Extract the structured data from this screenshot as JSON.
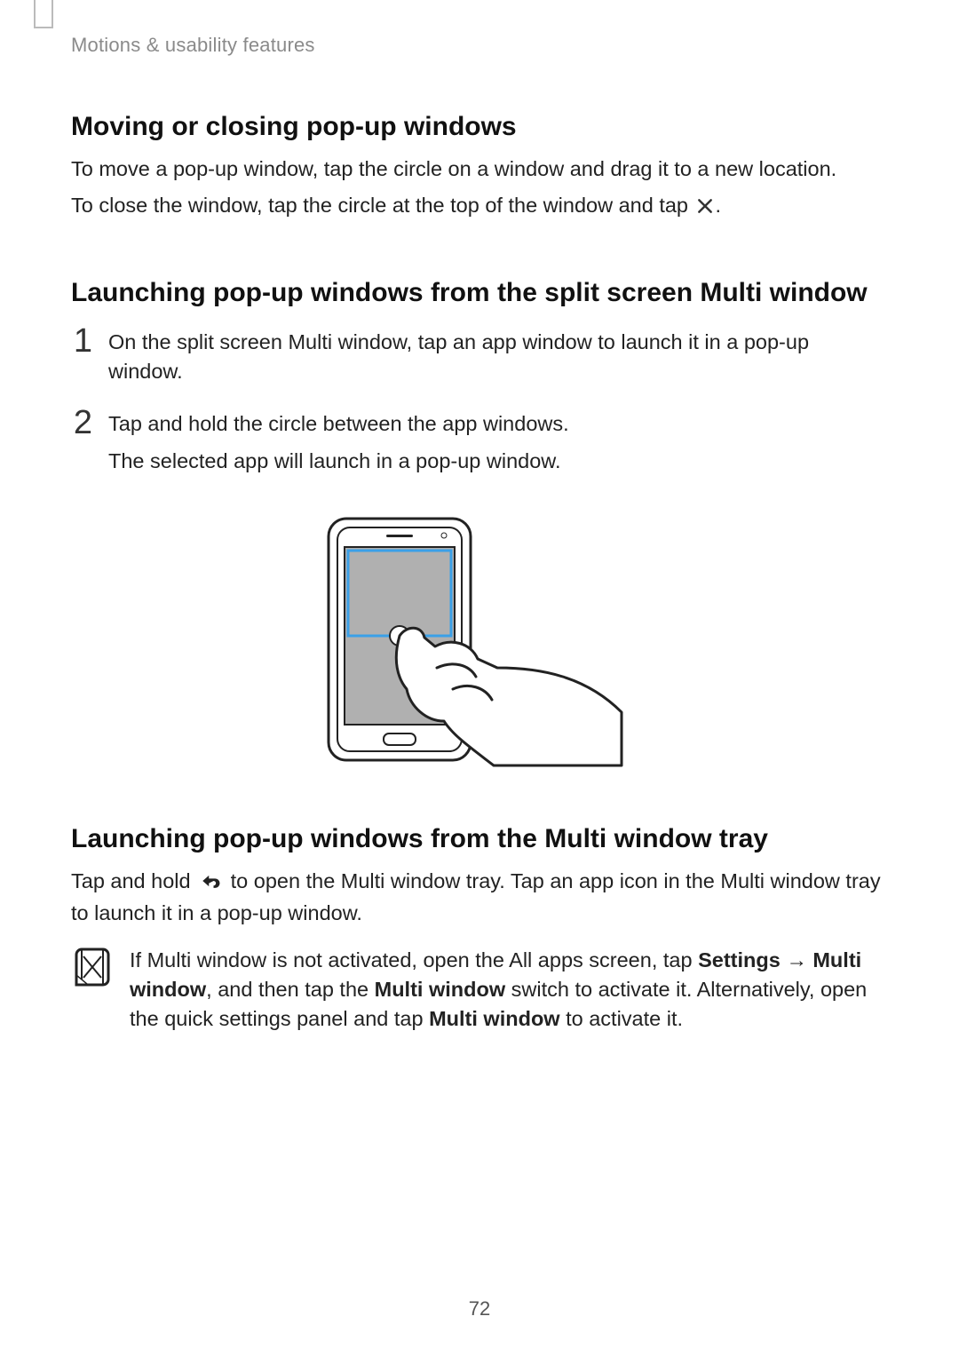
{
  "running_header": "Motions & usability features",
  "section1": {
    "title": "Moving or closing pop-up windows",
    "p1": "To move a pop-up window, tap the circle on a window and drag it to a new location.",
    "p2_pre": "To close the window, tap the circle at the top of the window and tap ",
    "p2_post": "."
  },
  "section2": {
    "title": "Launching pop-up windows from the split screen Multi window",
    "step1_num": "1",
    "step1_text": "On the split screen Multi window, tap an app window to launch it in a pop-up window.",
    "step2_num": "2",
    "step2_text_a": "Tap and hold the circle between the app windows.",
    "step2_text_b": "The selected app will launch in a pop-up window."
  },
  "section3": {
    "title": "Launching pop-up windows from the Multi window tray",
    "p1_pre": "Tap and hold ",
    "p1_post": " to open the Multi window tray. Tap an app icon in the Multi window tray to launch it in a pop-up window.",
    "note_pre": "If Multi window is not activated, open the All apps screen, tap ",
    "note_b1": "Settings",
    "note_arrow": " → ",
    "note_b2": "Multi window",
    "note_mid1": ", and then tap the ",
    "note_b3": "Multi window",
    "note_mid2": " switch to activate it. Alternatively, open the quick settings panel and tap ",
    "note_b4": "Multi window",
    "note_post": " to activate it."
  },
  "page_number": "72"
}
